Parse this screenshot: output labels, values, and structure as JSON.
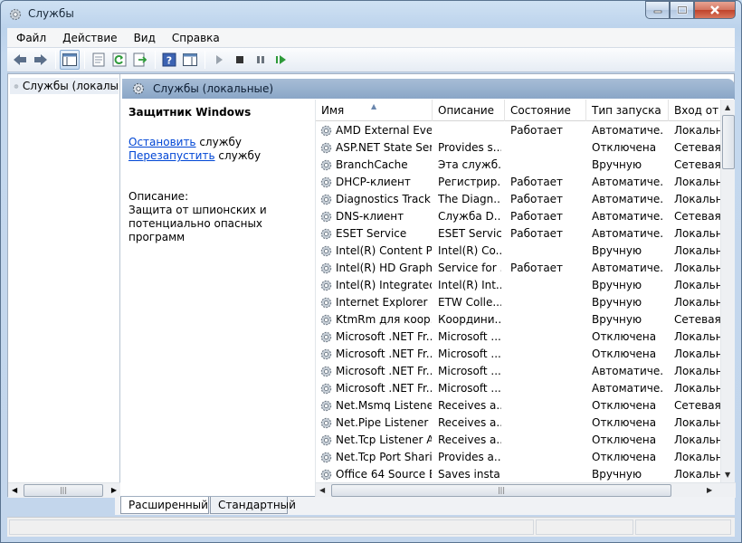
{
  "window": {
    "title": "Службы",
    "icon": "gear-icon",
    "accent": "#8aa6c7"
  },
  "menu": [
    "Файл",
    "Действие",
    "Вид",
    "Справка"
  ],
  "toolbar_icons": [
    "back-arrow-icon",
    "forward-arrow-icon",
    "show-console-tree-icon",
    "properties-icon",
    "refresh-icon",
    "export-list-icon",
    "help-icon",
    "show-action-pane-icon",
    "play-icon",
    "stop-icon",
    "pause-icon",
    "restart-icon"
  ],
  "tree": {
    "item_label": "Службы (локалы"
  },
  "panel": {
    "header_title": "Службы (локальные)"
  },
  "detail": {
    "service_name": "Защитник Windows",
    "stop_link": "Остановить",
    "stop_suffix": " службу",
    "restart_link": "Перезапустить",
    "restart_suffix": " службу",
    "description_label": "Описание:",
    "description_text": "Защита от шпионских  и потенциально опасных программ"
  },
  "columns": [
    "Имя",
    "Описание",
    "Состояние",
    "Тип запуска",
    "Вход от и"
  ],
  "services": [
    [
      "AMD External Eve...",
      "",
      "Работает",
      "Автоматиче...",
      "Локальн"
    ],
    [
      "ASP.NET State Ser...",
      "Provides s...",
      "",
      "Отключена",
      "Сетевая с"
    ],
    [
      "BranchCache",
      "Эта служб...",
      "",
      "Вручную",
      "Сетевая с"
    ],
    [
      "DHCP-клиент",
      "Регистрир...",
      "Работает",
      "Автоматиче...",
      "Локальн"
    ],
    [
      "Diagnostics Tracki...",
      "The Diagn...",
      "Работает",
      "Автоматиче...",
      "Локальн"
    ],
    [
      "DNS-клиент",
      "Служба D...",
      "Работает",
      "Автоматиче...",
      "Сетевая с"
    ],
    [
      "ESET Service",
      "ESET Service",
      "Работает",
      "Автоматиче...",
      "Локальн"
    ],
    [
      "Intel(R) Content P...",
      "Intel(R) Co...",
      "",
      "Вручную",
      "Локальн"
    ],
    [
      "Intel(R) HD Graphi...",
      "Service for ...",
      "Работает",
      "Автоматиче...",
      "Локальн"
    ],
    [
      "Intel(R) Integrated...",
      "Intel(R) Int...",
      "",
      "Вручную",
      "Локальн"
    ],
    [
      "Internet Explorer E...",
      "ETW Colle...",
      "",
      "Вручную",
      "Локальн"
    ],
    [
      "KtmRm для коор...",
      "Координи...",
      "",
      "Вручную",
      "Сетевая с"
    ],
    [
      "Microsoft .NET Fr...",
      "Microsoft ...",
      "",
      "Отключена",
      "Локальн"
    ],
    [
      "Microsoft .NET Fr...",
      "Microsoft ...",
      "",
      "Отключена",
      "Локальн"
    ],
    [
      "Microsoft .NET Fr...",
      "Microsoft ...",
      "",
      "Автоматиче...",
      "Локальн"
    ],
    [
      "Microsoft .NET Fr...",
      "Microsoft ...",
      "",
      "Автоматиче...",
      "Локальн"
    ],
    [
      "Net.Msmq Listene...",
      "Receives a...",
      "",
      "Отключена",
      "Сетевая с"
    ],
    [
      "Net.Pipe Listener ...",
      "Receives a...",
      "",
      "Отключена",
      "Локальн"
    ],
    [
      "Net.Tcp Listener A...",
      "Receives a...",
      "",
      "Отключена",
      "Локальн"
    ],
    [
      "Net.Tcp Port Shari...",
      "Provides a...",
      "",
      "Отключена",
      "Локальн"
    ],
    [
      "Office 64 Source E...",
      "Saves insta...",
      "",
      "Вручную",
      "Локальн"
    ]
  ],
  "tabs": [
    "Расширенный",
    "Стандартный"
  ],
  "scroll_grip": "|||"
}
